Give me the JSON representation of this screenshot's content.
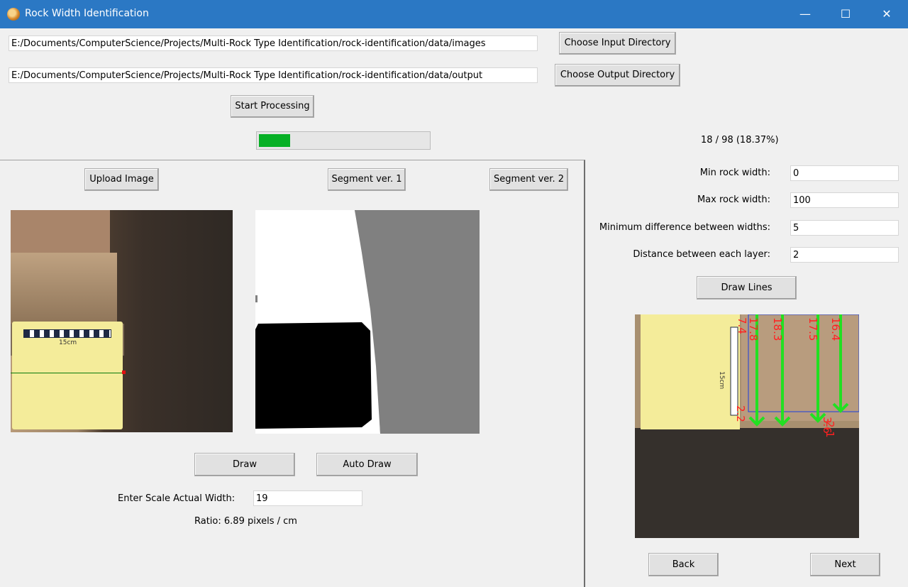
{
  "window": {
    "title": "Rock Width Identification",
    "minimize_glyph": "—",
    "maximize_glyph": "☐",
    "close_glyph": "✕",
    "icon": "rock-app-icon"
  },
  "directories": {
    "input_path": "E:/Documents/ComputerScience/Projects/Multi-Rock Type Identification/rock-identification/data/images",
    "output_path": "E:/Documents/ComputerScience/Projects/Multi-Rock Type Identification/rock-identification/data/output",
    "choose_input_label": "Choose Input Directory",
    "choose_output_label": "Choose Output Directory"
  },
  "processing": {
    "start_label": "Start Processing",
    "progress_fraction": 0.1837,
    "progress_text": "18 / 98 (18.37%)",
    "progress_color": "#06b025"
  },
  "left": {
    "upload_label": "Upload Image",
    "segment1_label": "Segment ver. 1",
    "segment2_label": "Segment ver. 2",
    "draw_label": "Draw",
    "auto_draw_label": "Auto Draw",
    "scale_label": "Enter Scale Actual Width:",
    "scale_value": "19",
    "ratio_text": "Ratio: 6.89 pixels / cm",
    "card_scale_text": "15cm"
  },
  "right": {
    "params": [
      {
        "label": "Min rock width:",
        "value": "0"
      },
      {
        "label": "Max rock width:",
        "value": "100"
      },
      {
        "label": "Minimum difference between widths:",
        "value": "5"
      },
      {
        "label": "Distance between each layer:",
        "value": "2"
      }
    ],
    "draw_lines_label": "Draw Lines",
    "back_label": "Back",
    "next_label": "Next",
    "overlay_labels": [
      "7.4",
      "17.8",
      "18.3",
      "17.5",
      "16.4",
      "2.2",
      "2.1",
      "3.6"
    ],
    "card_scale_text": "15cm",
    "line_color": "#22e022",
    "label_color": "#ff2020"
  }
}
